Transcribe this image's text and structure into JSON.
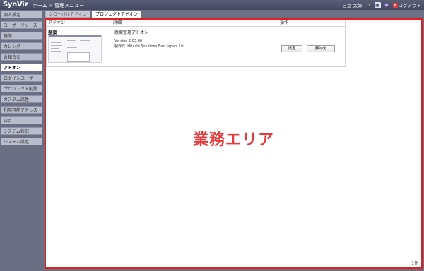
{
  "header": {
    "logo": "SynViz",
    "breadcrumb_home": "ホーム",
    "breadcrumb_sep": "»",
    "breadcrumb_current": "管理メニュー",
    "user": "日立 太郎",
    "logout": "ログアウト",
    "icons": [
      "home-icon",
      "window-icon",
      "gem-icon",
      "close-icon"
    ]
  },
  "sidebar": {
    "items": [
      {
        "label": "個人設定",
        "active": false
      },
      {
        "label": "ユーザ・リソース",
        "active": false
      },
      {
        "label": "権限",
        "active": false
      },
      {
        "label": "カレンダ",
        "active": false
      },
      {
        "label": "お知らせ",
        "active": false
      },
      {
        "label": "アドオン",
        "active": true
      },
      {
        "label": "ログインユーザ",
        "active": false
      },
      {
        "label": "プロジェクト削除",
        "active": false
      },
      {
        "label": "カスタム属性",
        "active": false
      },
      {
        "label": "利用可能アドレス",
        "active": false
      },
      {
        "label": "ログ",
        "active": false
      },
      {
        "label": "システム状況",
        "active": false
      },
      {
        "label": "システム設定",
        "active": false
      }
    ]
  },
  "tabs": [
    {
      "label": "グローバルアドオン",
      "active": false
    },
    {
      "label": "プロジェクトアドオン",
      "active": true
    }
  ],
  "table": {
    "headers": [
      "アドオン",
      "詳細",
      "操作"
    ],
    "rows": [
      {
        "name": "懸案",
        "detail_name": "懸案管理アドオン",
        "version": "Version 2.03.00",
        "maker": "製作元: Hitachi Solutions East Japan, Ltd.",
        "settings_label": "設定",
        "disable_label": "無効化"
      }
    ]
  },
  "work_area_label": "業務エリア",
  "count": "1件",
  "colors": {
    "header": "#4b5068",
    "sidebar": "#6b6f84",
    "highlight_border": "#e02020",
    "work_area_text": "#e83a3a"
  }
}
